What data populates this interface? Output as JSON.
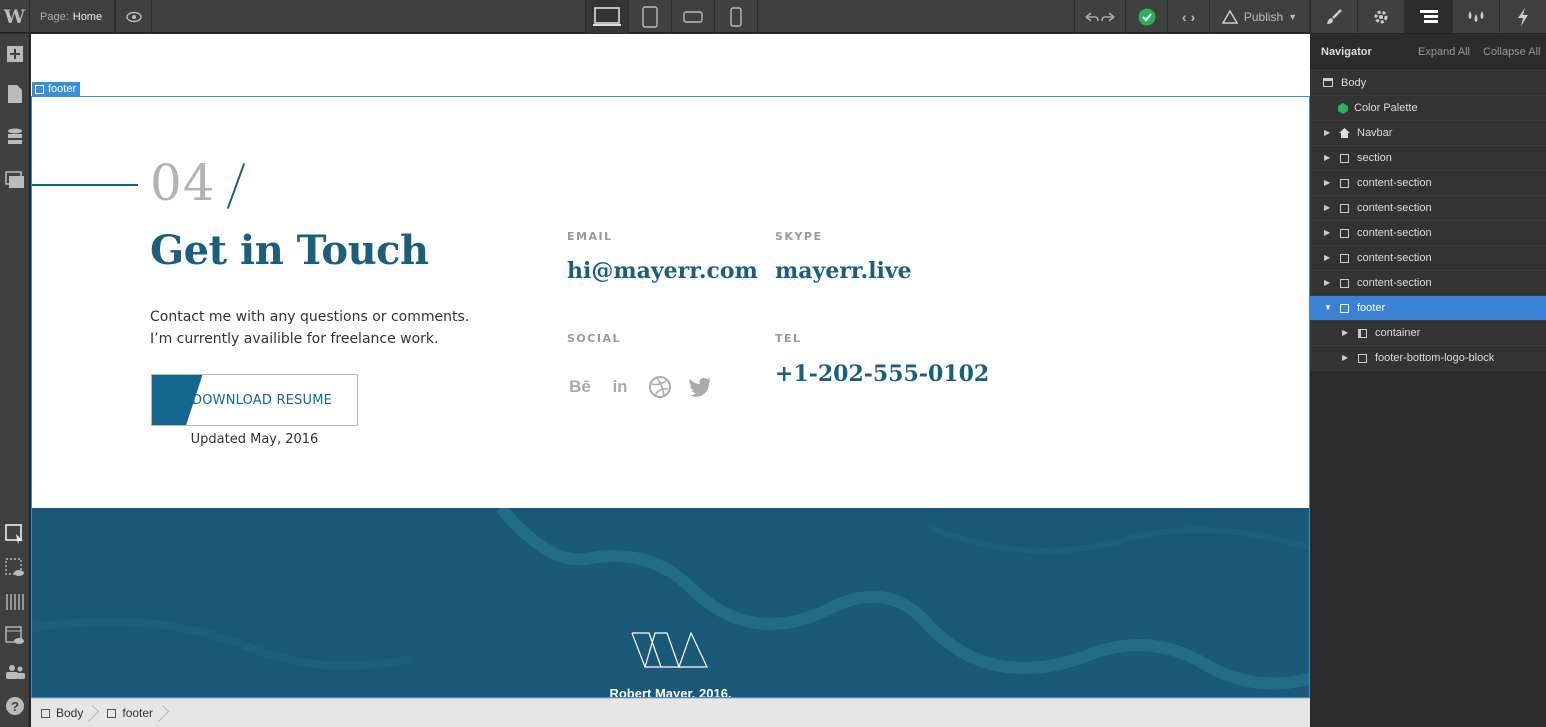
{
  "topbar": {
    "logo": "W",
    "page_label": "Page:",
    "page_value": "Home",
    "publish_label": "Publish",
    "devices": [
      "desktop-icon",
      "tablet-icon",
      "mobile-landscape-icon",
      "mobile-portrait-icon"
    ]
  },
  "right_tabs": [
    "brush-icon",
    "gear-icon",
    "navigator-icon",
    "drops-icon",
    "bolt-icon"
  ],
  "left_tools": [
    "add-icon",
    "pages-icon",
    "cms-icon",
    "assets-icon",
    "select-icon",
    "preview-icon",
    "grid-icon",
    "layout-preview-icon",
    "users-icon",
    "help-icon"
  ],
  "canvas": {
    "selected_tag": "footer",
    "section_number": "04",
    "heading": "Get in Touch",
    "desc_line1": "Contact me with any questions or comments.",
    "desc_line2": "I’m currently availible for freelance work.",
    "download_label": "DOWNLOAD RESUME",
    "updated": "Updated May, 2016",
    "email_label": "EMAIL",
    "email_value": "hi@mayerr.com",
    "skype_label": "SKYPE",
    "skype_value": "mayerr.live",
    "social_label": "SOCIAL",
    "tel_label": "TEL",
    "tel_value": "+1-202-555-0102",
    "social_icons": [
      "Bē",
      "in",
      "◎",
      "🐦"
    ],
    "copyright": "Robert Mayer, 2016."
  },
  "breadcrumb": [
    "Body",
    "footer"
  ],
  "navigator": {
    "title": "Navigator",
    "expand_all": "Expand All",
    "collapse_all": "Collapse All",
    "items": [
      {
        "label": "Body"
      },
      {
        "label": "Color Palette"
      },
      {
        "label": "Navbar"
      },
      {
        "label": "section"
      },
      {
        "label": "content-section"
      },
      {
        "label": "content-section"
      },
      {
        "label": "content-section"
      },
      {
        "label": "content-section"
      },
      {
        "label": "content-section"
      },
      {
        "label": "footer"
      },
      {
        "label": "container"
      },
      {
        "label": "footer-bottom-logo-block"
      }
    ]
  },
  "colors": {
    "accent_blue": "#1b5f7e",
    "selection": "#3b82d6",
    "footer_band": "#1a5a78"
  }
}
